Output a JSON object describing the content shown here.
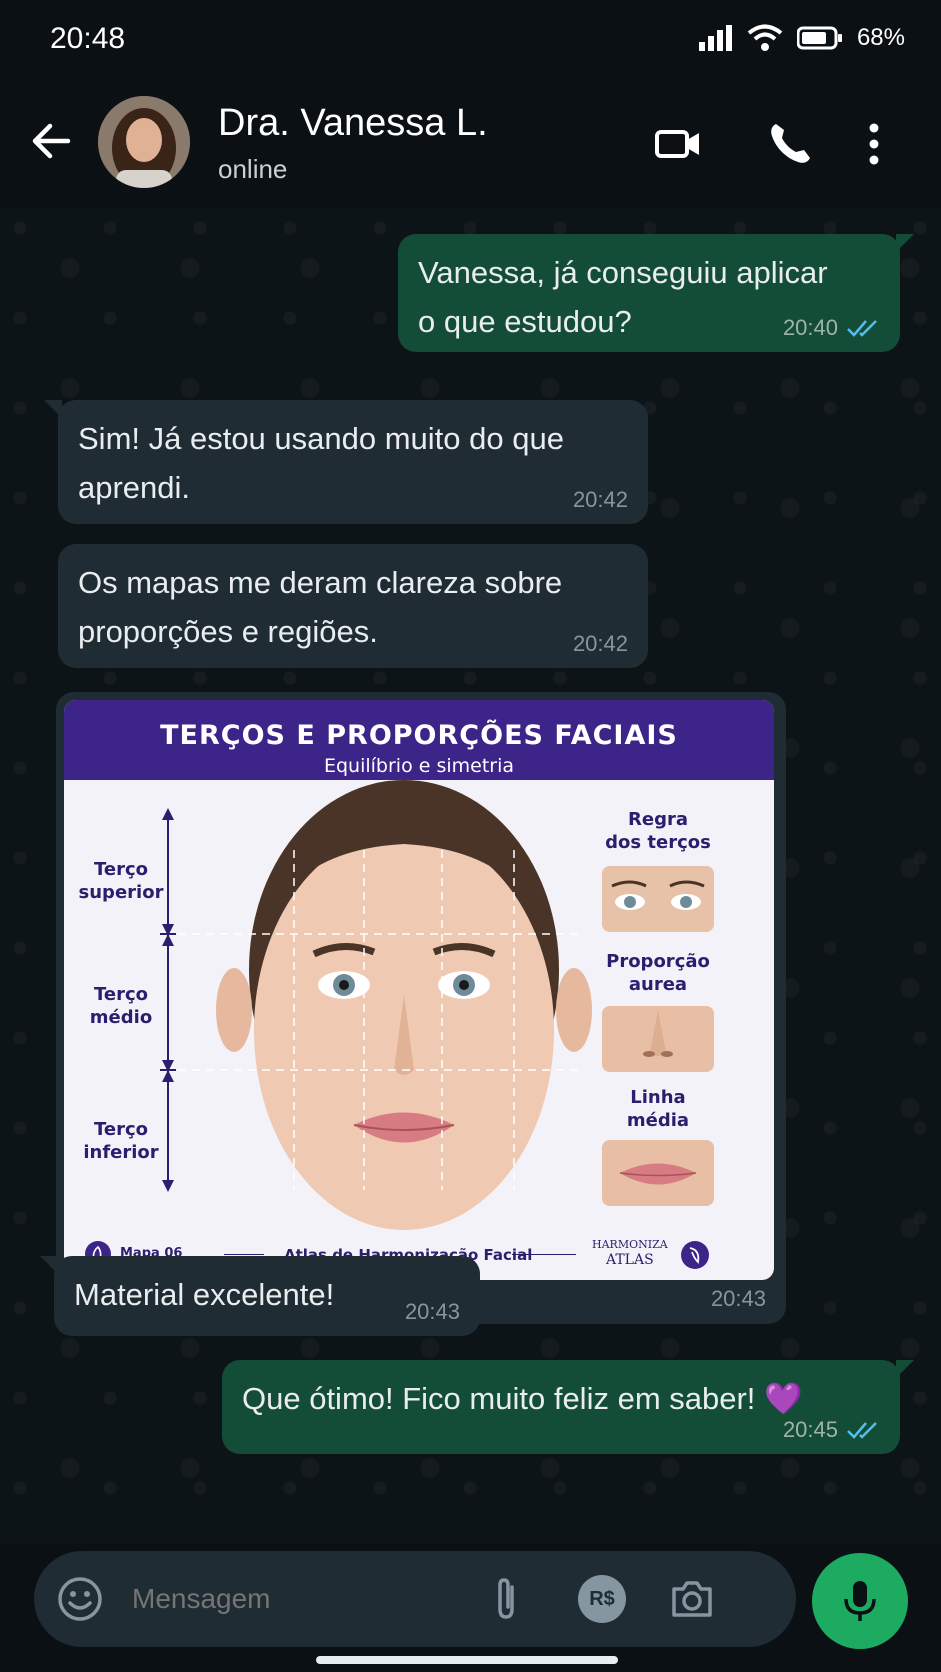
{
  "status_bar": {
    "time": "20:48",
    "battery": "68%"
  },
  "header": {
    "contact_name": "Dra. Vanessa L.",
    "contact_status": "online"
  },
  "messages": [
    {
      "direction": "out",
      "lines": [
        "Vanessa, já conseguiu aplicar",
        "o que estudou?"
      ],
      "time": "20:40",
      "read": true
    },
    {
      "direction": "in",
      "lines": [
        "Sim! Já estou usando muito do que",
        "aprendi."
      ],
      "time": "20:42"
    },
    {
      "direction": "in",
      "lines": [
        "Os mapas me deram clareza sobre",
        "proporções e regiões."
      ],
      "time": "20:42"
    },
    {
      "direction": "in",
      "type": "image",
      "time": "20:43"
    },
    {
      "direction": "in",
      "lines": [
        "Material excelente!"
      ],
      "time": "20:43"
    },
    {
      "direction": "out",
      "lines": [
        "Que ótimo! Fico muito feliz em saber! 💜"
      ],
      "time": "20:45",
      "read": true
    }
  ],
  "poster": {
    "title": "TERÇOS E PROPORÇÕES FACIAIS",
    "subtitle": "Equilíbrio e simetria",
    "thirds": [
      {
        "line1": "Terço",
        "line2": "superior"
      },
      {
        "line1": "Terço",
        "line2": "médio"
      },
      {
        "line1": "Terço",
        "line2": "inferior"
      }
    ],
    "side_items": [
      {
        "line1": "Regra",
        "line2": "dos terços"
      },
      {
        "line1": "Proporção",
        "line2": "aurea"
      },
      {
        "line1": "Linha",
        "line2": "média"
      }
    ],
    "footer_map": "Mapa 06",
    "footer_center": "Atlas de Harmonização Facial",
    "footer_brand_line1": "HARMONIZA",
    "footer_brand_line2": "ATLAS"
  },
  "composer": {
    "placeholder": "Mensagem",
    "currency_label": "R$"
  },
  "colors": {
    "outgoing": "#144d37",
    "incoming": "#1f2c33",
    "accent": "#1daa61",
    "poster_purple": "#3c2488",
    "read_ticks": "#53bdeb"
  },
  "icons": [
    "back-arrow-icon",
    "video-call-icon",
    "phone-icon",
    "more-vert-icon",
    "emoji-icon",
    "attach-icon",
    "payment-icon",
    "camera-icon",
    "mic-icon"
  ]
}
